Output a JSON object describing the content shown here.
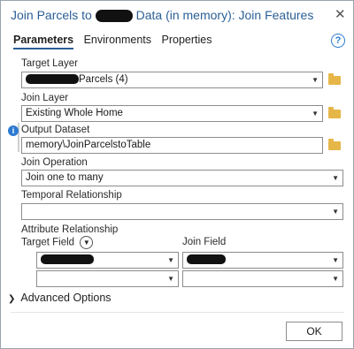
{
  "window": {
    "title_prefix": "Join Parcels to",
    "title_suffix": "Data (in memory): Join Features"
  },
  "tabs": [
    {
      "label": "Parameters",
      "active": true
    },
    {
      "label": "Environments",
      "active": false
    },
    {
      "label": "Properties",
      "active": false
    }
  ],
  "params": {
    "target_layer": {
      "label": "Target Layer",
      "value": "Parcels (4)"
    },
    "join_layer": {
      "label": "Join Layer",
      "value": "Existing Whole Home"
    },
    "output_dataset": {
      "label": "Output Dataset",
      "value": "memory\\JoinParcelstoTable"
    },
    "join_operation": {
      "label": "Join Operation",
      "value": "Join one to many"
    },
    "temporal_relationship": {
      "label": "Temporal Relationship",
      "value": ""
    },
    "attribute_relationship": {
      "label": "Attribute Relationship",
      "target_field_label": "Target Field",
      "join_field_label": "Join Field"
    }
  },
  "advanced_options": {
    "label": "Advanced Options"
  },
  "buttons": {
    "ok": "OK"
  },
  "icons": {
    "close": "close-icon",
    "help": "help-icon",
    "info": "info-icon",
    "browse": "folder-icon",
    "dropdown": "chevron-down-icon",
    "expand": "chevron-right-icon"
  },
  "colors": {
    "title": "#2b5f96",
    "folder": "#e6b648",
    "info": "#2d7ad2"
  }
}
